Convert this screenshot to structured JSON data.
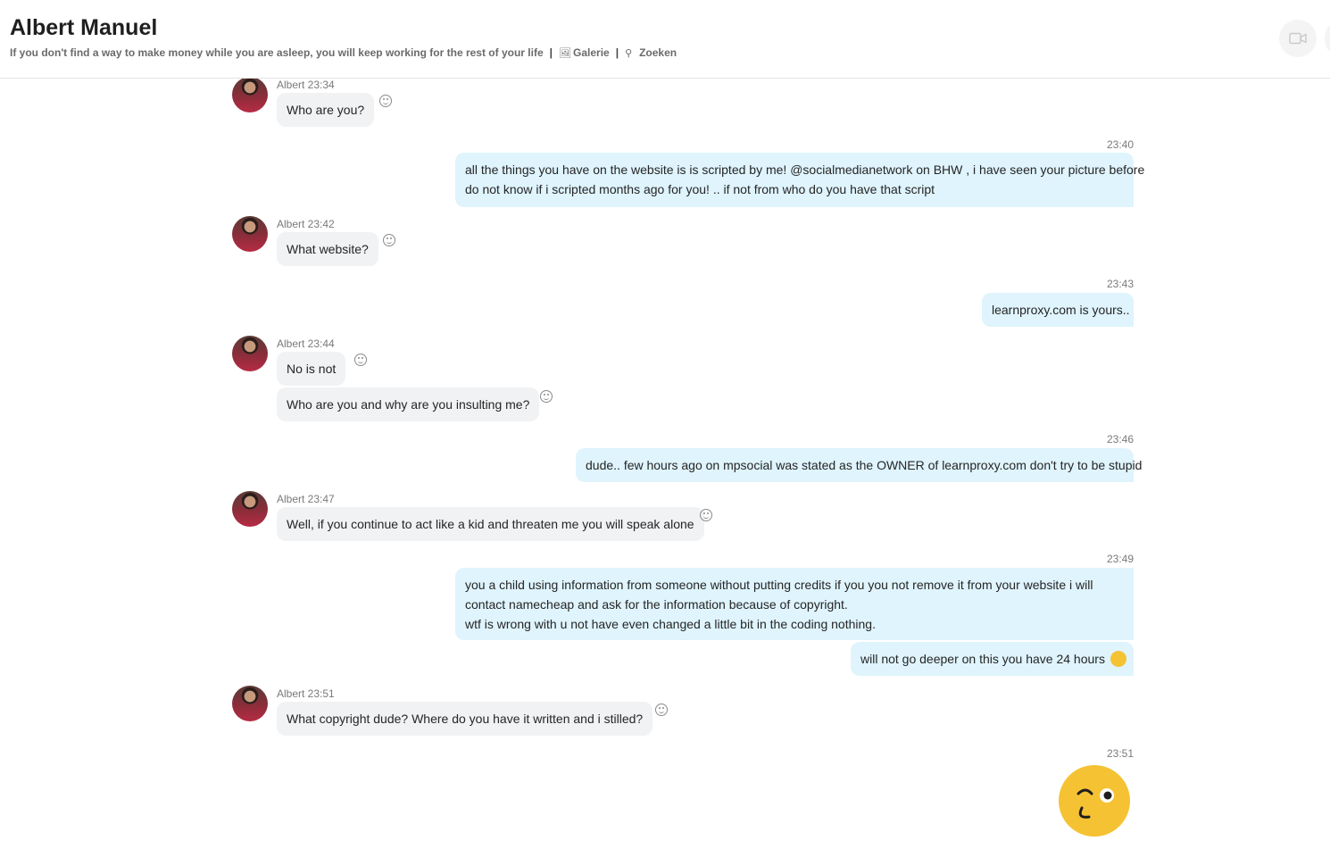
{
  "header": {
    "title": "Albert Manuel",
    "subtitle": "If you don't find a way to make money while you are asleep, you will keep working for the rest of your life",
    "separator": "|",
    "gallery": "Galerie",
    "search": "Zoeken",
    "icons": {
      "gallery": "image-icon",
      "search": "search-icon",
      "video": "video-camera-icon"
    }
  },
  "messages": [
    {
      "sender": "Albert 23:34",
      "text": "Who are you?"
    },
    {
      "time": "23:40",
      "text_line1": "all the things you have on the website is is scripted by me! @socialmedianetwork on BHW , i have seen your picture before",
      "text_line2": "do not know if i scripted months ago for you! .. if not from who do you have that script"
    },
    {
      "sender": "Albert 23:42",
      "text": "What website?"
    },
    {
      "time": "23:43",
      "text": "learnproxy.com is yours.."
    },
    {
      "sender": "Albert 23:44",
      "text": "No is not",
      "text2": "Who are you and why are you insulting me?"
    },
    {
      "time": "23:46",
      "text": "dude.. few hours ago on mpsocial was stated as the OWNER of learnproxy.com don't try to be stupid"
    },
    {
      "sender": "Albert 23:47",
      "text": "Well, if you continue to act like a kid and threaten me you will speak alone"
    },
    {
      "time": "23:49",
      "text_line1": "you a child using information from someone without putting credits if you you not remove it from your website i will",
      "text_line2": "contact namecheap and ask for the information because of copyright.",
      "text_line3": "wtf is wrong with u not have even changed a little bit in the coding nothing.",
      "text2": "will not go deeper on this you have 24 hours"
    },
    {
      "sender": "Albert 23:51",
      "text": "What copyright dude? Where do you have it written  and i stilled?"
    },
    {
      "time": "23:51",
      "sticker": "wink-emoji"
    }
  ],
  "colors": {
    "outgoing": "#dff4fd",
    "incoming": "#f1f2f4",
    "emoji": "#f5c233"
  }
}
